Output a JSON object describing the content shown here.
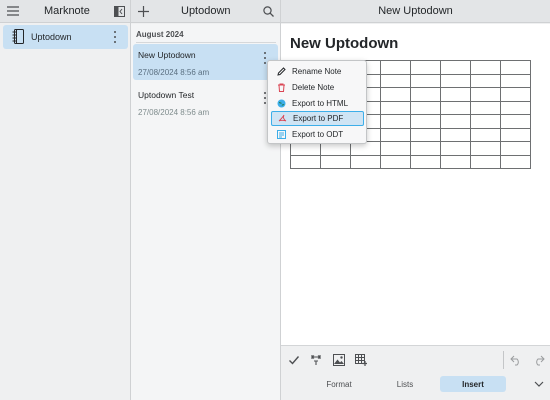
{
  "app": {
    "title": "Marknote"
  },
  "notes_header": {
    "title": "Uptodown"
  },
  "editor_header": {
    "title": "New Uptodown"
  },
  "sidebar": {
    "notebooks": [
      {
        "label": "Uptodown",
        "selected": true
      }
    ]
  },
  "notes_list": {
    "group_label": "August 2024",
    "items": [
      {
        "title": "New Uptodown",
        "date": "27/08/2024 8:56 am",
        "selected": true
      },
      {
        "title": "Uptodown Test",
        "date": "27/08/2024 8:56 am",
        "selected": false
      }
    ]
  },
  "context_menu": {
    "items": [
      {
        "label": "Rename Note",
        "icon": "pencil-icon"
      },
      {
        "label": "Delete Note",
        "icon": "trash-icon"
      },
      {
        "label": "Export to HTML",
        "icon": "globe-icon"
      },
      {
        "label": "Export to PDF",
        "icon": "pdf-icon",
        "highlighted": true
      },
      {
        "label": "Export to ODT",
        "icon": "document-icon"
      }
    ]
  },
  "editor": {
    "doc_title": "New Uptodown",
    "table": {
      "rows": 8,
      "cols": 8
    }
  },
  "toolbar": {
    "icons": [
      "checkbox-icon",
      "link-icon",
      "image-icon",
      "table-icon",
      "undo-icon",
      "redo-icon"
    ],
    "tabs": [
      {
        "label": "Format",
        "active": false
      },
      {
        "label": "Lists",
        "active": false
      },
      {
        "label": "Insert",
        "active": true
      }
    ]
  },
  "colors": {
    "accent": "#3daee9",
    "selection": "#c8e0f3",
    "header_bg": "#e3e5e7",
    "pdf_red": "#da4453"
  }
}
